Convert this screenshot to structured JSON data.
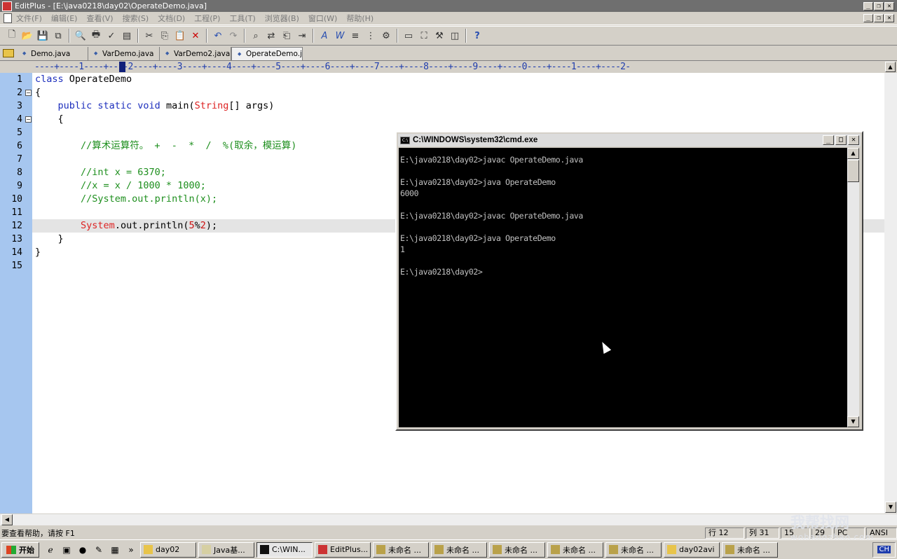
{
  "app": {
    "title": "EditPlus - [E:\\java0218\\day02\\OperateDemo.java]"
  },
  "menu": [
    "文件(F)",
    "编辑(E)",
    "查看(V)",
    "搜索(S)",
    "文档(D)",
    "工程(P)",
    "工具(T)",
    "浏览器(B)",
    "窗口(W)",
    "帮助(H)"
  ],
  "toolbar_icons": [
    "new-file-icon",
    "open-icon",
    "save-icon",
    "save-all-icon",
    "print-preview-icon",
    "print-icon",
    "spellcheck-icon",
    "page-icon",
    "cut-icon",
    "copy-icon",
    "paste-icon",
    "delete-icon",
    "undo-icon",
    "redo-icon",
    "find-icon",
    "replace-icon",
    "find-in-files-icon",
    "goto-icon",
    "font-icon",
    "word-wrap-icon",
    "line-number-icon",
    "column-icon",
    "settings-icon",
    "screen-icon",
    "fullscreen-icon",
    "tools-icon",
    "cliptext-icon",
    "help-icon"
  ],
  "tabs": [
    "Demo.java",
    "VarDemo.java",
    "VarDemo2.java",
    "OperateDemo.java"
  ],
  "ruler": "----+----1----+----2----+----3----+----4----+----5----+----6----+----7----+----8----+----9----+----0----+----1----+----2-",
  "line_numbers": [
    "1",
    "2",
    "3",
    "4",
    "5",
    "6",
    "7",
    "8",
    "9",
    "10",
    "11",
    "12",
    "13",
    "14",
    "15"
  ],
  "code": {
    "l1_kw": "class",
    "l1_name": " OperateDemo",
    "l2": "{",
    "l3_kw": "    public static void",
    "l3_main": " main(",
    "l3_type": "String",
    "l3_args": "[] args)",
    "l4": "    {",
    "l6": "        //算术运算符。 +  -  *  /  %(取余，模运算)",
    "l8": "        //int x = 6370;",
    "l9": "        //x = x / 1000 * 1000;",
    "l10": "        //System.out.println(x);",
    "l12_indent": "        ",
    "l12_type": "System",
    "l12_call": ".out.println(",
    "l12_n1": "5",
    "l12_op": "%",
    "l12_n2": "2",
    "l12_end": ");",
    "l13": "    }",
    "l14": "}"
  },
  "cmd": {
    "title": "C:\\WINDOWS\\system32\\cmd.exe",
    "lines": [
      "E:\\java0218\\day02>javac OperateDemo.java",
      "",
      "E:\\java0218\\day02>java OperateDemo",
      "6000",
      "",
      "E:\\java0218\\day02>javac OperateDemo.java",
      "",
      "E:\\java0218\\day02>java OperateDemo",
      "1",
      "",
      "E:\\java0218\\day02>"
    ]
  },
  "status": {
    "help": "要查看帮助，请按 F1",
    "row": "行 12",
    "col": "列 31",
    "f1": "15",
    "f2": "29",
    "mode": "PC",
    "encoding": "ANSI"
  },
  "watermark": {
    "text": "我帮找网",
    "sub": "wobangzhao.com"
  },
  "taskbar": {
    "start": "开始",
    "tasks": [
      "day02",
      "Java基...",
      "C:\\WIN...",
      "EditPlus...",
      "未命名 ...",
      "未命名 ...",
      "未命名 ...",
      "未命名 ...",
      "未命名 ...",
      "day02avi",
      "未命名 ..."
    ],
    "lang": "CH"
  }
}
